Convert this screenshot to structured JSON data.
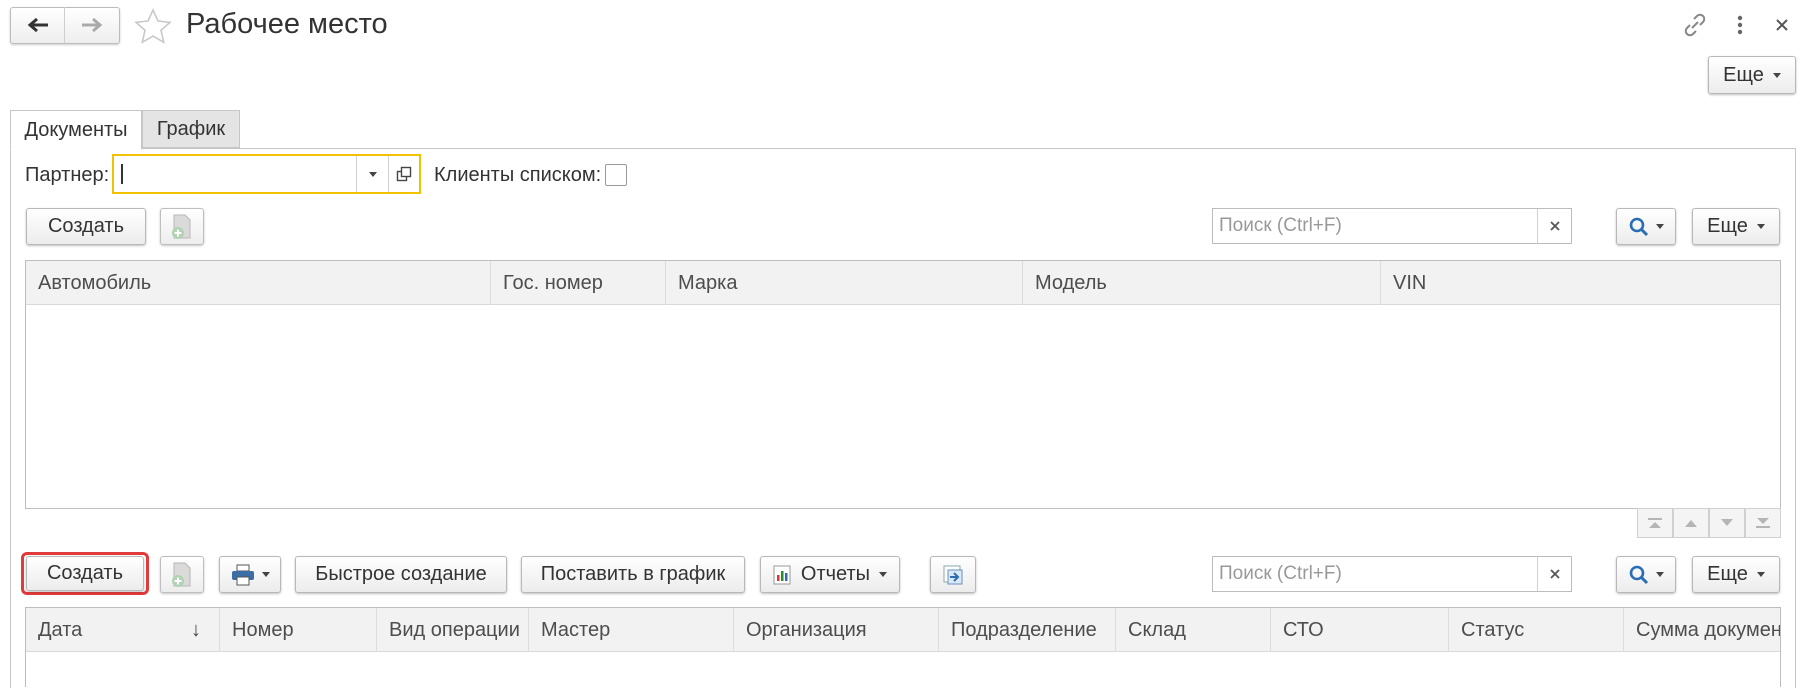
{
  "window": {
    "title": "Рабочее место",
    "more_label": "Еще"
  },
  "tabs": [
    {
      "label": "Документы",
      "active": true
    },
    {
      "label": "График",
      "active": false
    }
  ],
  "filters": {
    "partner_label": "Партнер:",
    "partner_value": "",
    "clients_list_label": "Клиенты списком:",
    "clients_list_checked": false
  },
  "cars_toolbar": {
    "create_label": "Создать",
    "search_placeholder": "Поиск (Ctrl+F)",
    "more_label": "Еще"
  },
  "cars_table": {
    "columns": [
      "Автомобиль",
      "Гос. номер",
      "Марка",
      "Модель",
      "VIN"
    ],
    "rows": []
  },
  "docs_toolbar": {
    "create_label": "Создать",
    "quick_create_label": "Быстрое создание",
    "schedule_label": "Поставить в график",
    "reports_label": "Отчеты",
    "search_placeholder": "Поиск (Ctrl+F)",
    "more_label": "Еще"
  },
  "docs_table": {
    "columns": [
      "Дата",
      "Номер",
      "Вид операции",
      "Мастер",
      "Организация",
      "Подразделение",
      "Склад",
      "СТО",
      "Статус",
      "Сумма докумен"
    ],
    "sort_indicator": "↓",
    "rows": []
  },
  "colors": {
    "highlight_border": "#e03a3a",
    "partner_focus_border": "#f2c200",
    "search_icon": "#2a6db5"
  }
}
